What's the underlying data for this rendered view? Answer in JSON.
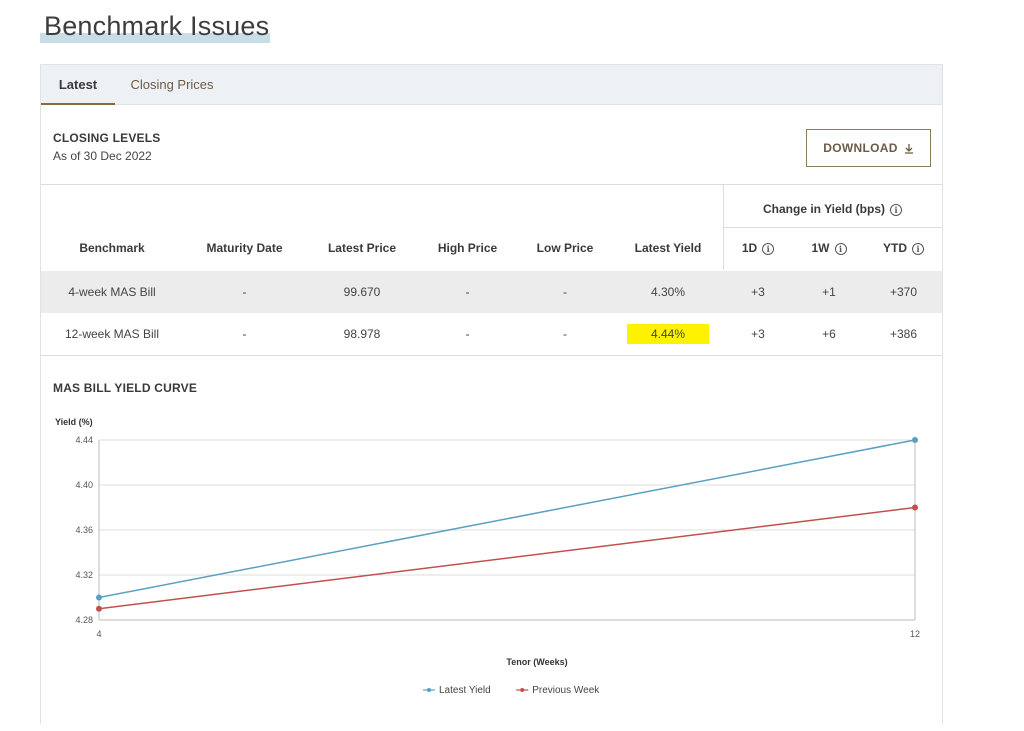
{
  "page": {
    "title": "Benchmark Issues"
  },
  "tabs": [
    {
      "label": "Latest",
      "active": true
    },
    {
      "label": "Closing Prices",
      "active": false
    }
  ],
  "closing": {
    "title": "CLOSING LEVELS",
    "as_of": "As of 30 Dec 2022",
    "download_label": "DOWNLOAD",
    "download_icon": "download-icon"
  },
  "table": {
    "group_header": "Change in Yield (bps)",
    "columns": [
      "Benchmark",
      "Maturity Date",
      "Latest Price",
      "High Price",
      "Low Price",
      "Latest Yield",
      "1D",
      "1W",
      "YTD"
    ],
    "rows": [
      [
        "4-week MAS Bill",
        "-",
        "99.670",
        "-",
        "-",
        "4.30%",
        "+3",
        "+1",
        "+370"
      ],
      [
        "12-week MAS Bill",
        "-",
        "98.978",
        "-",
        "-",
        "4.44%",
        "+3",
        "+6",
        "+386"
      ]
    ],
    "highlight_color": "#fff200"
  },
  "chart_section": {
    "title": "MAS BILL YIELD CURVE"
  },
  "chart_data": {
    "type": "line",
    "ylabel": "Yield (%)",
    "xlabel": "Tenor (Weeks)",
    "x": [
      4,
      12
    ],
    "x_ticks": [
      "4",
      "12"
    ],
    "y_ticks": [
      "4.28",
      "4.32",
      "4.36",
      "4.40",
      "4.44"
    ],
    "ylim": [
      4.28,
      4.44
    ],
    "grid": true,
    "legend_position": "bottom-center",
    "series": [
      {
        "name": "Latest Yield",
        "values": [
          4.3,
          4.44
        ],
        "color": "#5aa0c0"
      },
      {
        "name": "Previous Week",
        "values": [
          4.29,
          4.38
        ],
        "color": "#c0504d"
      }
    ]
  }
}
